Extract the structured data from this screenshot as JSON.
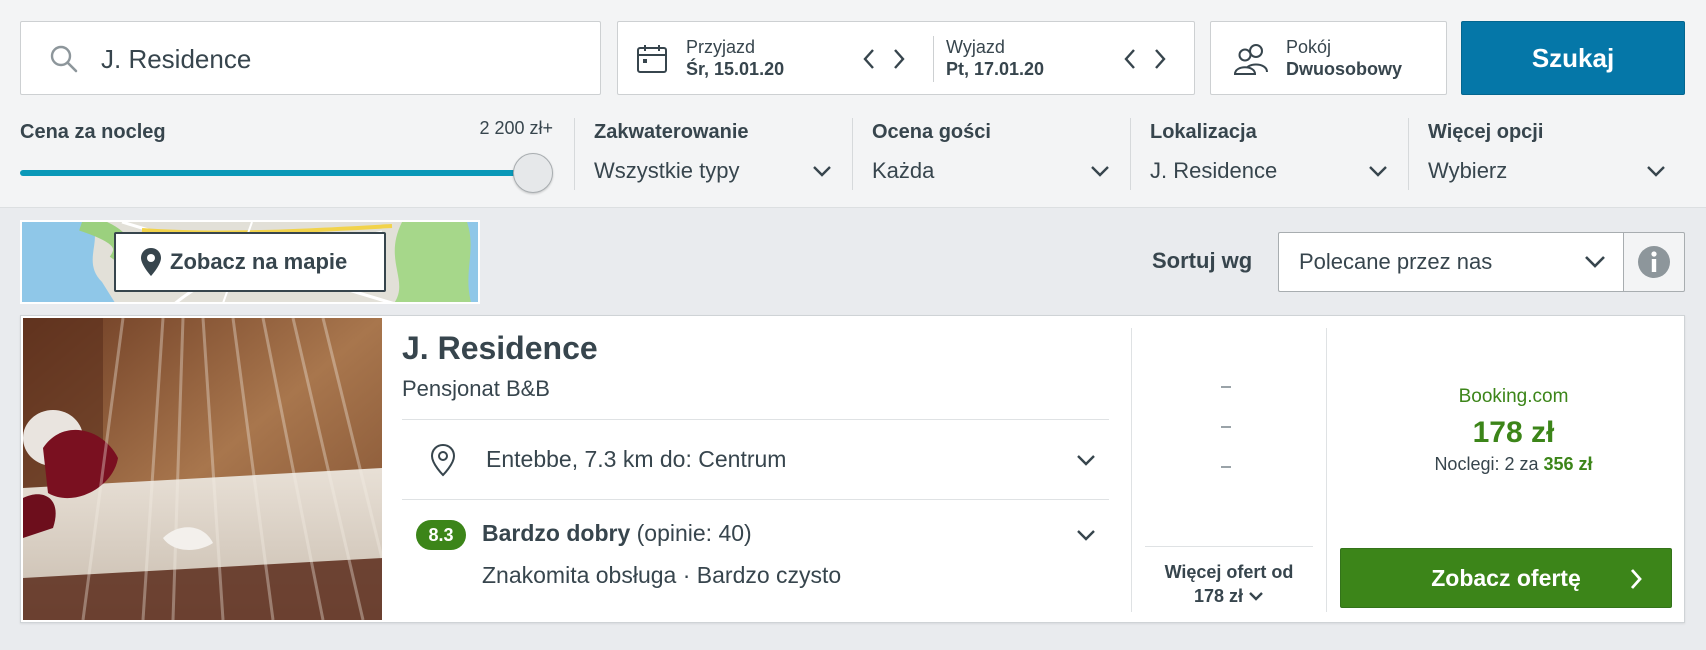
{
  "search": {
    "query": "J. Residence",
    "button_label": "Szukaj"
  },
  "dates": {
    "checkin_label": "Przyjazd",
    "checkin_value": "Śr, 15.01.20",
    "checkout_label": "Wyjazd",
    "checkout_value": "Pt, 17.01.20"
  },
  "room": {
    "label": "Pokój",
    "value": "Dwuosobowy"
  },
  "filters": {
    "price": {
      "label": "Cena za nocleg",
      "max": "2 200 zł+",
      "level_percent": 100
    },
    "accommodation": {
      "label": "Zakwaterowanie",
      "value": "Wszystkie typy"
    },
    "rating": {
      "label": "Ocena gości",
      "value": "Każda"
    },
    "location": {
      "label": "Lokalizacja",
      "value": "J. Residence"
    },
    "more": {
      "label": "Więcej opcji",
      "value": "Wybierz"
    }
  },
  "map": {
    "button_label": "Zobacz na mapie"
  },
  "sort": {
    "label": "Sortuj wg",
    "value": "Polecane przez nas"
  },
  "result": {
    "name": "J. Residence",
    "type": "Pensjonat B&B",
    "location": "Entebbe, 7.3 km do: Centrum",
    "score": "8.3",
    "rating_word": "Bardzo dobry",
    "reviews": "(opinie: 40)",
    "tags": "Znakomita obsługa · Bardzo czysto",
    "more_offers_line1": "Więcej ofert od",
    "more_offers_line2": "178 zł",
    "partner": "Booking.com",
    "price": "178 zł",
    "nights_prefix": "Noclegi: 2 za",
    "nights_total": "356 zł",
    "offer_button": "Zobacz ofertę"
  },
  "colors": {
    "brand_blue": "#0577a8",
    "deal_green": "#3c8519",
    "slider": "#0a98b8",
    "text": "#37454d"
  }
}
